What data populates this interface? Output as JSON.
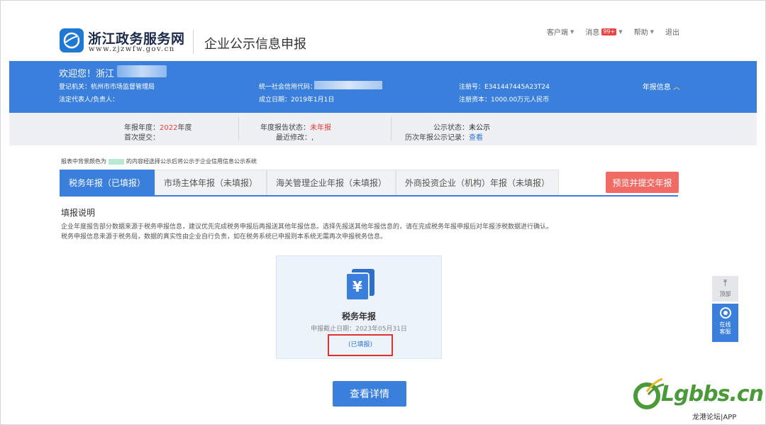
{
  "header": {
    "logo_name": "浙江政务服务网",
    "logo_url": "www.zjzwfw.gov.cn",
    "system_title": "企业公示信息申报",
    "menu": {
      "client": "客户端",
      "messages": "消息",
      "messages_badge": "99+",
      "help": "帮助",
      "logout": "退出"
    }
  },
  "band": {
    "welcome": "欢迎您！浙江",
    "reg_org_label": "登记机关：",
    "reg_org_value": "杭州市市场监督管理局",
    "legal_rep_label": "法定代表人/负责人：",
    "credit_code_label": "统一社会信用代码：",
    "established_label": "成立日期：",
    "established_value": "2019年1月1日",
    "reg_no_label": "注册号：",
    "reg_no_value": "E341447445A23T24",
    "capital_label": "注册资本：",
    "capital_value": "1000.00万元人民币",
    "annual_info": "年报信息"
  },
  "info": {
    "year_label": "年报年度：",
    "year_value": "2022",
    "year_suffix": "年度",
    "first_submit_label": "首次提交：",
    "report_status_label": "年度报告状态：",
    "report_status_value": "未年报",
    "last_modified_label": "最近修改：",
    "public_status_label": "公示状态：",
    "public_status_value": "未公示",
    "history_label": "历次年报公示记录：",
    "history_link": "查看"
  },
  "notice": {
    "before": "报表中背景颜色为",
    "after": "的内容经选择公示后将公示于企业信用信息公示系统"
  },
  "tabs": [
    {
      "label": "税务年报（已填报）"
    },
    {
      "label": "市场主体年报（未填报）"
    },
    {
      "label": "海关管理企业年报（未填报）"
    },
    {
      "label": "外商投资企业（机构）年报（未填报）"
    }
  ],
  "submit_button": "预览并提交年报",
  "instructions": {
    "heading": "填报说明",
    "line1": "企业年度报告部分数据来源于税务申报信息，建议优先完成税务申报后再报送其他年报信息。选择先报送其他年报信息的，请在完成税务年报申报后对年报涉税数据进行确认。",
    "line2": "税务申报信息来源于税务局，数据的真实性由企业自行负责，如在税务系统已申报则本系统无需再次申报税务信息。"
  },
  "card": {
    "title": "税务年报",
    "deadline": "申报截止日期：2023年05月31日",
    "status": "(已填报)"
  },
  "view_button": "查看详情",
  "side_tools": {
    "top": "顶部",
    "chat_line1": "在线",
    "chat_line2": "客服"
  },
  "watermark": {
    "text": "Lgbbs.cn",
    "sub": "龙港论坛|APP"
  },
  "colors": {
    "primary_blue": "#3a7fdc",
    "submit_red": "#ef6b63",
    "status_red": "#e23c3c",
    "link_blue": "#2f74d0"
  }
}
